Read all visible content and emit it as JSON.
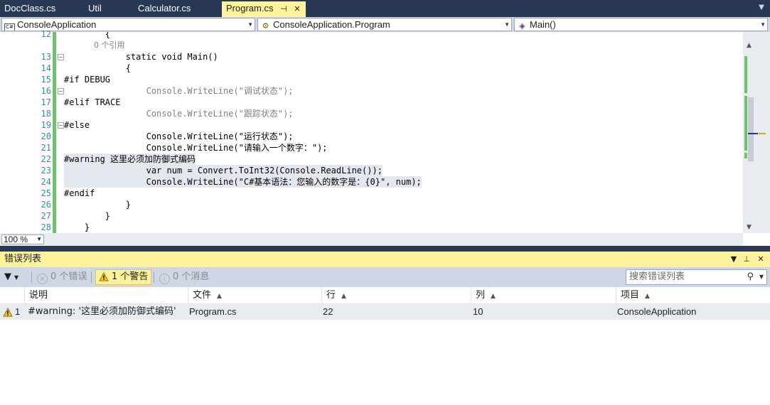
{
  "tabs": [
    {
      "label": "DocClass.cs",
      "active": false
    },
    {
      "label": "Util",
      "active": false
    },
    {
      "label": "Calculator.cs",
      "active": false
    },
    {
      "label": "Program.cs",
      "active": true
    }
  ],
  "navbar": {
    "project": "ConsoleApplication",
    "class": "ConsoleApplication.Program",
    "member": "Main()",
    "project_icon": "C#"
  },
  "editor": {
    "zoom": "100 %",
    "lines": [
      {
        "n": "12",
        "text": "        {"
      },
      {
        "n": "",
        "text": "            0 个引用",
        "kind": "ref"
      },
      {
        "n": "13",
        "text": "            static void Main()"
      },
      {
        "n": "14",
        "text": "            {"
      },
      {
        "n": "15",
        "text": "#if DEBUG"
      },
      {
        "n": "16",
        "text": "                Console.WriteLine(\"调试状态\");"
      },
      {
        "n": "17",
        "text": "#elif TRACE"
      },
      {
        "n": "18",
        "text": "                Console.WriteLine(\"跟踪状态\");"
      },
      {
        "n": "19",
        "text": "#else"
      },
      {
        "n": "20",
        "text": "                Console.WriteLine(\"运行状态\");"
      },
      {
        "n": "21",
        "text": "                Console.WriteLine(\"请输入一个数字：\");"
      },
      {
        "n": "22",
        "text": "#warning 这里必须加防御式编码"
      },
      {
        "n": "23",
        "text": "                var num = Convert.ToInt32(Console.ReadLine());"
      },
      {
        "n": "24",
        "text": "                Console.WriteLine(\"C#基本语法：您输入的数字是：{0}\", num);"
      },
      {
        "n": "25",
        "text": "#endif"
      },
      {
        "n": "26",
        "text": "            }"
      },
      {
        "n": "27",
        "text": "        }"
      },
      {
        "n": "28",
        "text": "    }"
      }
    ]
  },
  "error_list": {
    "title": "错误列表",
    "filter_errors": "0 个错误",
    "filter_warnings": "1 个警告",
    "filter_messages": "0 个消息",
    "search_placeholder": "搜索错误列表",
    "columns": {
      "description": "说明",
      "file": "文件",
      "line": "行",
      "column": "列",
      "project": "项目"
    },
    "rows": [
      {
        "index": "1",
        "description": "#warning: '这里必须加防御式编码'",
        "file": "Program.cs",
        "line": "22",
        "column": "10",
        "project": "ConsoleApplication"
      }
    ]
  },
  "icons": {
    "pin": "pin-icon",
    "close": "close-icon",
    "warning": "warning-icon",
    "error": "error-icon",
    "info": "info-icon",
    "filter": "filter-icon",
    "search": "search-icon"
  },
  "colors": {
    "accent_yellow": "#fff29d",
    "chrome_blue": "#293955",
    "toolbar": "#cfd6e5",
    "change_bar": "#6cc36c"
  }
}
